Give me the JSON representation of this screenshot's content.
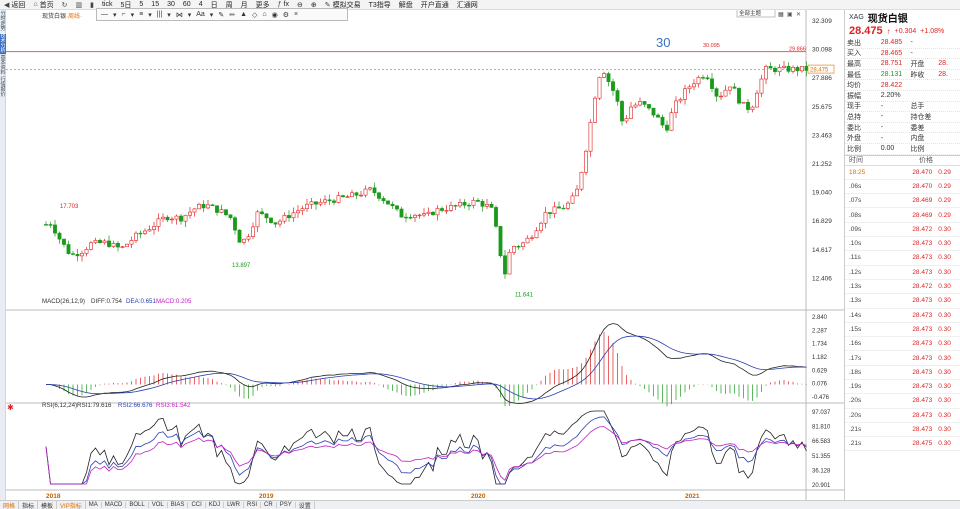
{
  "topbar": {
    "items": [
      {
        "icon": "back-icon",
        "label": "返回"
      },
      {
        "icon": "home-icon",
        "label": "首页"
      },
      {
        "icon": "refresh-icon",
        "label": ""
      },
      {
        "icon": "kline-icon",
        "label": ""
      },
      {
        "icon": "bar-icon",
        "label": ""
      },
      {
        "icon": "",
        "label": "tick"
      },
      {
        "icon": "",
        "label": "5日"
      },
      {
        "icon": "",
        "label": "5"
      },
      {
        "icon": "",
        "label": "15"
      },
      {
        "icon": "",
        "label": "30"
      },
      {
        "icon": "",
        "label": "60"
      },
      {
        "icon": "",
        "label": "4"
      },
      {
        "icon": "",
        "label": "日"
      },
      {
        "icon": "",
        "label": "周"
      },
      {
        "icon": "",
        "label": "月"
      },
      {
        "icon": "",
        "label": "更多"
      },
      {
        "icon": "formula-icon",
        "label": "fx"
      },
      {
        "icon": "zoom-in-icon",
        "label": "⊖"
      },
      {
        "icon": "zoom-out-icon",
        "label": "⊕"
      },
      {
        "icon": "draw-icon",
        "label": "模拟交易"
      },
      {
        "icon": "",
        "label": "T3指导"
      },
      {
        "icon": "",
        "label": "解盘"
      },
      {
        "icon": "",
        "label": "开户直通"
      },
      {
        "icon": "",
        "label": "汇通网"
      }
    ]
  },
  "left_rail": [
    "分时走势",
    "技术分析",
    "基本资料",
    "行情报价"
  ],
  "chart_header": {
    "title": "现货白银",
    "period": "周线"
  },
  "tool_panel": {
    "items": [
      "—",
      "▾",
      "⌐",
      "▾",
      "≡",
      "▾",
      "|||",
      "▾",
      "⋈",
      "▾",
      "Aa",
      "▾",
      "✎",
      "✏",
      "▲",
      "◇",
      "⌂",
      "◉",
      "⚙",
      "×"
    ]
  },
  "main_badges": {
    "all_indicators": "全部主题",
    "price_annotation": "30",
    "high_label": "30.095",
    "hline_value": "29.866",
    "current_value": "28.475"
  },
  "y_axis_main": [
    "32.309",
    "30.098",
    "27.886",
    "25.675",
    "23.463",
    "21.252",
    "19.040",
    "16.829",
    "14.617",
    "12.406"
  ],
  "x_axis": [
    "2018",
    "2019",
    "2020",
    "2021"
  ],
  "annotations": {
    "high_2018": "17.703",
    "low_2018": "13.897",
    "low_2020": "11.641"
  },
  "macd": {
    "label": "MACD(26,12,9)",
    "diff": "DIFF:0.754",
    "dea": "DEA:0.651",
    "macd": "MACD:0.205",
    "y_axis": [
      "2.840",
      "2.287",
      "1.734",
      "1.182",
      "0.629",
      "0.076",
      "-0.476"
    ]
  },
  "rsi": {
    "label": "RSI(6,12,24)",
    "rsi1": "RSI1:79.616",
    "rsi2": "RSI2:66.676",
    "rsi3": "RSI3:61.542",
    "y_axis": [
      "97.037",
      "81.810",
      "66.583",
      "51.355",
      "36.128",
      "20.901"
    ]
  },
  "bottom_tabs": [
    "指标",
    "模板",
    "VIP指标",
    "MA",
    "MACD",
    "BOLL",
    "VOL",
    "BIAS",
    "CCI",
    "KDJ",
    "LWR",
    "RSI",
    "CR",
    "PSY",
    "设置"
  ],
  "bottom_left_label": "网格",
  "quote": {
    "code": "XAG",
    "name": "现货白银",
    "price": "28.475",
    "arrow": "↑",
    "change": "+0.304",
    "change_pct": "+1.08%",
    "rows": [
      {
        "a": "卖出",
        "b": "28.485",
        "c": "-",
        "d": ""
      },
      {
        "a": "买入",
        "b": "28.465",
        "c": "-",
        "d": ""
      },
      {
        "a": "最高",
        "b": "28.751",
        "c": "开盘",
        "d": "28."
      },
      {
        "a": "最低",
        "b": "28.131",
        "c": "昨收",
        "d": "28."
      },
      {
        "a": "均价",
        "b": "28.422",
        "c": "",
        "d": ""
      },
      {
        "a": "振幅",
        "b": "2.20%",
        "c": "",
        "d": ""
      },
      {
        "a": "现手",
        "b": "-",
        "c": "总手",
        "d": ""
      },
      {
        "a": "总持",
        "b": "-",
        "c": "持仓差",
        "d": ""
      },
      {
        "a": "委比",
        "b": "-",
        "c": "委差",
        "d": ""
      },
      {
        "a": "外盘",
        "b": "-",
        "c": "内盘",
        "d": ""
      },
      {
        "a": "比例",
        "b": "0.00",
        "c": "比例",
        "d": ""
      }
    ],
    "ticks_head": {
      "time": "时间",
      "price": "价格"
    },
    "ticks": [
      {
        "t": "18:25",
        "p": "28.470",
        "v": "0.29"
      },
      {
        "t": ".06s",
        "p": "28.470",
        "v": "0.29"
      },
      {
        "t": ".07s",
        "p": "28.469",
        "v": "0.29"
      },
      {
        "t": ".08s",
        "p": "28.469",
        "v": "0.29"
      },
      {
        "t": ".09s",
        "p": "28.472",
        "v": "0.30"
      },
      {
        "t": ".10s",
        "p": "28.473",
        "v": "0.30"
      },
      {
        "t": ".11s",
        "p": "28.473",
        "v": "0.30"
      },
      {
        "t": ".12s",
        "p": "28.473",
        "v": "0.30"
      },
      {
        "t": ".13s",
        "p": "28.472",
        "v": "0.30"
      },
      {
        "t": ".13s",
        "p": "28.473",
        "v": "0.30"
      },
      {
        "t": ".14s",
        "p": "28.473",
        "v": "0.30"
      },
      {
        "t": ".15s",
        "p": "28.473",
        "v": "0.30"
      },
      {
        "t": ".16s",
        "p": "28.473",
        "v": "0.30"
      },
      {
        "t": ".17s",
        "p": "28.473",
        "v": "0.30"
      },
      {
        "t": ".18s",
        "p": "28.473",
        "v": "0.30"
      },
      {
        "t": ".19s",
        "p": "28.473",
        "v": "0.30"
      },
      {
        "t": ".20s",
        "p": "28.473",
        "v": "0.30"
      },
      {
        "t": ".20s",
        "p": "28.473",
        "v": "0.30"
      },
      {
        "t": ".21s",
        "p": "28.473",
        "v": "0.30"
      },
      {
        "t": ".21s",
        "p": "28.475",
        "v": "0.30"
      }
    ]
  },
  "colors": {
    "up": "#e02020",
    "down": "#1a9a1a",
    "macd_dea": "#2a3fb0",
    "rsi2": "#2a3fb0",
    "rsi3": "#c020c0",
    "hline": "#e06060"
  }
}
